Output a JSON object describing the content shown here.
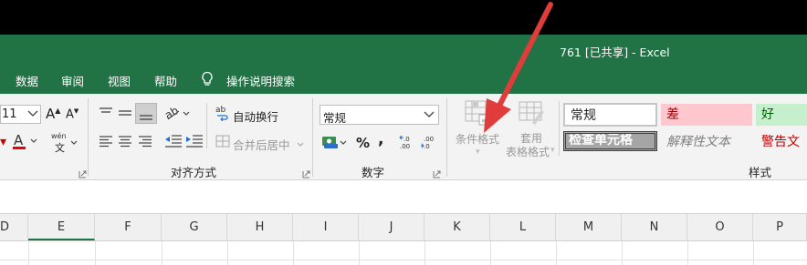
{
  "title_bar": {
    "document_title": "761  [已共享]  -  Excel"
  },
  "menu": {
    "items": [
      "数据",
      "审阅",
      "视图",
      "帮助"
    ],
    "search_label": "操作说明搜索"
  },
  "ribbon": {
    "font_size": "11",
    "wen_label": "wén",
    "wen_char": "文",
    "wrap_text": "自动换行",
    "merge_center": "合并后居中",
    "alignment_group": "对齐方式",
    "number_format": "常规",
    "percent": "%",
    "comma": ",",
    "number_group": "数字",
    "conditional_format": "条件格式",
    "table_format_line1": "套用",
    "table_format_line2": "表格格式",
    "styles_group": "样式",
    "styles": {
      "normal": "常规",
      "bad": "差",
      "good": "好",
      "check_cell": "检查单元格",
      "explanatory": "解释性文本",
      "warning": "警告文"
    }
  },
  "columns": [
    "D",
    "E",
    "F",
    "G",
    "H",
    "I",
    "J",
    "K",
    "L",
    "M",
    "N",
    "O",
    "P"
  ],
  "colors": {
    "excel_green": "#217346",
    "arrow_red": "#e03c3c",
    "bad_fill": "#ffc7ce",
    "good_fill": "#c6efce",
    "warning_text": "#c00000"
  }
}
